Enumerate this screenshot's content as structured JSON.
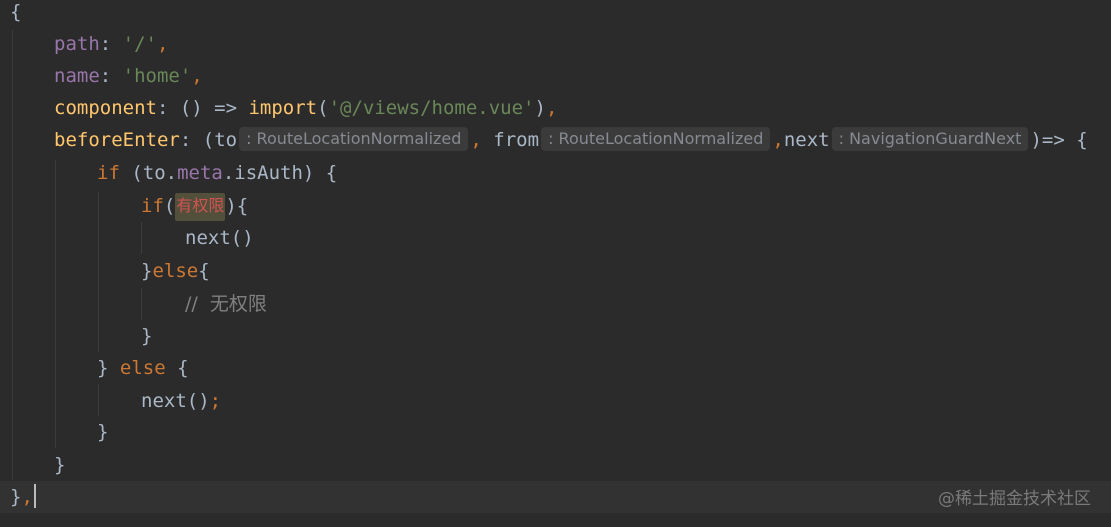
{
  "code": {
    "l1": {
      "brace": "{"
    },
    "l2": {
      "key": "path",
      "colon": ": ",
      "value": "'/'",
      "comma": ","
    },
    "l3": {
      "key": "name",
      "colon": ": ",
      "value": "'home'",
      "comma": ","
    },
    "l4": {
      "key": "component",
      "colon": ": ",
      "args": "() => ",
      "fn": "import",
      "open": "(",
      "value": "'@/views/home.vue'",
      "close": ")",
      "comma": ","
    },
    "l5": {
      "key": "beforeEnter",
      "colon": ": ",
      "open": "(",
      "p1": "to",
      "h1": ": RouteLocationNormalized",
      "c1": ",",
      "p2": " from",
      "h2": ": RouteLocationNormalized",
      "c2": ",",
      "p3": "next",
      "h3": ": NavigationGuardNext",
      "tail": ")=> {"
    },
    "l6": {
      "kw": "if",
      "pre": " (to.",
      "prop": "meta",
      "post": ".isAuth) {"
    },
    "l7": {
      "kw": "if",
      "open": "(",
      "todo": "有权限",
      "close": "){"
    },
    "l8": {
      "call": "next()"
    },
    "l9": {
      "close": "}",
      "kw": "else",
      "open": "{"
    },
    "l10": {
      "comment": "//  无权限"
    },
    "l11": {
      "close": "}"
    },
    "l12": {
      "close": "} ",
      "kw": "else",
      "open": " {"
    },
    "l13": {
      "call": "next()",
      "semi": ";"
    },
    "l14": {
      "close": "}"
    },
    "l15": {
      "close": "}"
    },
    "l16": {
      "close": "}",
      "comma": ","
    }
  },
  "watermark": "@稀土掘金技术社区",
  "colors": {
    "background": "#2b2b2b",
    "keyword": "#cc7832",
    "property": "#9876aa",
    "function": "#ffc66d",
    "string": "#6a8759",
    "comment": "#808080",
    "default": "#a9b7c6"
  }
}
